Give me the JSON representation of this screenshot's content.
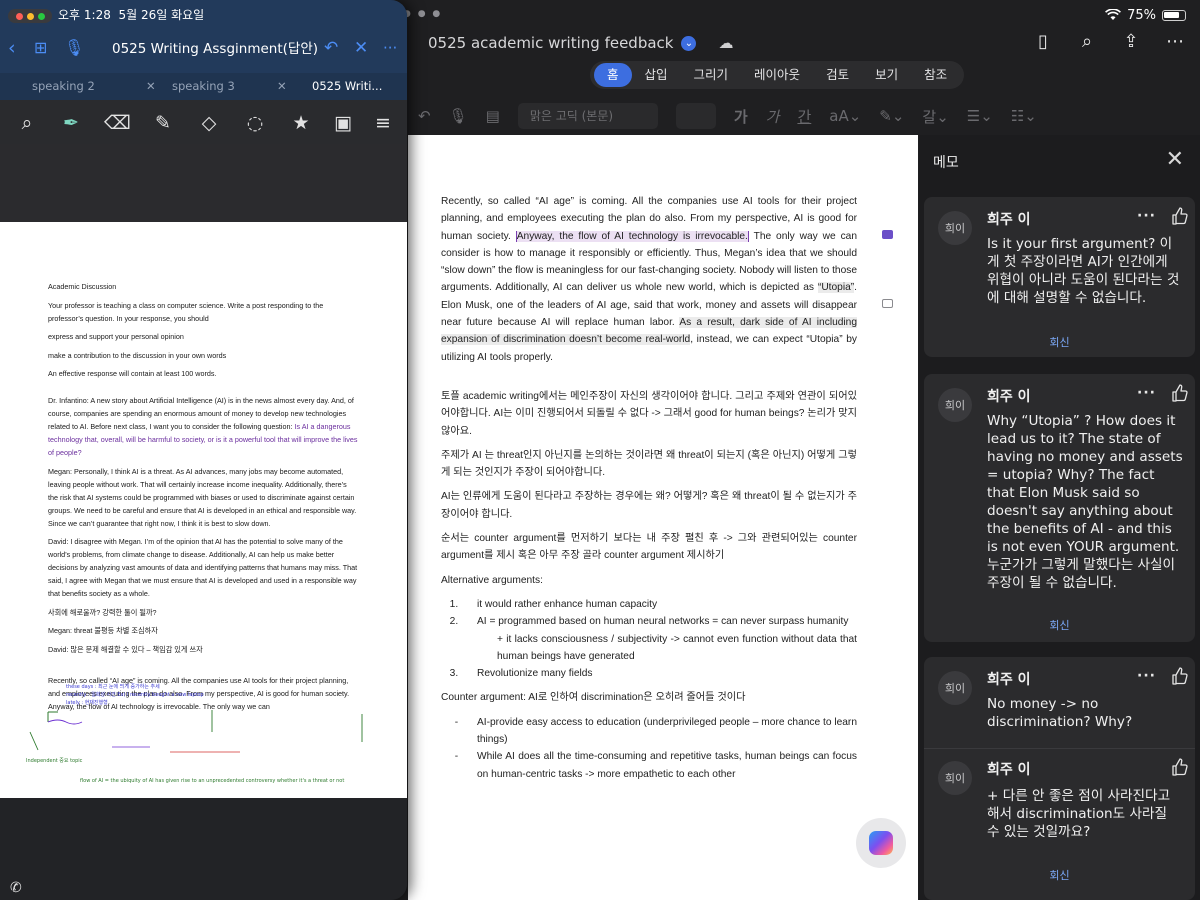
{
  "status": {
    "time": "오후 1:28",
    "date": "5월 26일 화요일",
    "battery": "75%"
  },
  "word": {
    "doc_title": "0525 academic writing feedback",
    "ribbon_tabs": [
      "홈",
      "삽입",
      "그리기",
      "레이아웃",
      "검토",
      "보기",
      "참조"
    ],
    "font_name": "맑은 고딕 (본문)",
    "paragraphs": {
      "p1_a": "Recently, so called “AI age” is coming. All the companies use AI tools for their project planning, and employees executing the plan do also. From my perspective, AI is good for human society. ",
      "p1_hl1": "Anyway, the flow of AI technology is irrevocable.",
      "p1_b": " The only way we can consider is how to manage it responsibly or efficiently. Thus, Megan’s idea that we should “slow down” the flow is meaningless for our fast-changing society. Nobody will listen to those arguments. Additionally, AI can deliver us whole new world, which is depicted as ",
      "p1_hl2": "“Utopia”",
      "p1_c": ". Elon Musk, one of the leaders of AI age, said that work, money and assets will disappear near future because AI will replace human labor. ",
      "p1_hl3": "As a result, dark side of AI including expansion of discrimination doesn’t become real-world",
      "p1_d": ", instead, we can expect “Utopia” by utilizing AI tools properly.",
      "k1": "토플 academic writing에서는 메인주장이 자신의 생각이어야 합니다. 그리고 주제와 연관이 되어있어야합니다. AI는 이미 진행되어서 되돌릴 수 없다 -> 그래서 good for human beings? 논리가 맞지 않아요.",
      "k2": "주제가 AI 는 threat인지 아닌지를 논의하는 것이라면 왜 threat이 되는지 (혹은 아닌지) 어떻게 그렇게 되는 것인지가 주장이 되어야합니다.",
      "k3": "AI는 인류에게 도움이 된다라고 주장하는 경우에는 왜? 어떻게? 혹은 왜 threat이 될 수 없는지가 주장이어야 합니다.",
      "k4": "순서는 counter argument를 먼저하기 보다는 내 주장 펼친 후 -> 그와 관련되어있는 counter argument를 제시 혹은 아무 주장 골라 counter argument 제시하기",
      "alt_heading": "Alternative arguments:",
      "alt_1": "it would rather enhance human capacity",
      "alt_2": "AI = programmed based on human neural networks = can never surpass humanity",
      "alt_2b": "+ it lacks consciousness / subjectivity -> cannot even function without data that human beings have generated",
      "alt_3": "Revolutionize many fields",
      "counter_heading": "Counter argument: AI로 인하여 discrimination은 오히려 줄어들 것이다",
      "counter_1": "AI-provide easy access to education (underprivileged people – more chance to learn things)",
      "counter_2": "While AI does all the time-consuming and repetitive tasks, human beings can focus on human-centric tasks -> more empathetic to each other"
    }
  },
  "memo": {
    "title": "메모",
    "reply_label": "회신",
    "comments": [
      {
        "avatar": "희이",
        "author": "희주 이",
        "text": "Is it your first argument?  이게 첫 주장이라면 AI가 인간에게 위협이 아니라 도움이 된다라는 것에 대해 설명할 수 없습니다."
      },
      {
        "avatar": "희이",
        "author": "희주 이",
        "text": "Why “Utopia” ? How does it lead us to it? The state of having no money and assets = utopia? Why? The fact that Elon Musk said so doesn't say anything about the benefits of AI - and this is not even YOUR argument. 누군가가 그렇게 말했다는 사실이 주장이 될 수 없습니다."
      },
      {
        "avatar": "희이",
        "author": "희주 이",
        "text": "No money -> no discrimination? Why?"
      },
      {
        "avatar": "희이",
        "author": "희주 이",
        "text": "+ 다른 안 좋은 점이 사라진다고 해서 discrimination도 사라질 수 있는 것일까요?"
      }
    ]
  },
  "notes": {
    "title": "0525 Writing Assginment(답안)",
    "tabs": [
      "speaking 2",
      "speaking 3",
      "0525 Writi..."
    ],
    "sheet": {
      "heading": "Academic Discussion",
      "s1": "Your professor is teaching a class on computer science. Write a post responding to the professor’s question.    In your response, you should",
      "s2": "express and support your personal opinion",
      "s3": "make a contribution to the discussion in your own words",
      "s4": "An effective response will contain at least 100 words.",
      "s5": "Dr. Infantino:   A new story about Artificial Intelligence (AI) is in the news almost every day.   And, of course, companies are spending an enormous amount of money to develop new technologies related to AI. Before next class, I want you to consider the following question: ",
      "s5_q": "Is AI a dangerous technology that, overall, will be harmful to society, or is it a powerful tool that will improve the lives of people?",
      "s6": "Megan: Personally, I think AI is a threat. As AI advances, many jobs may become automated, leaving people without work. That will certainly increase income inequality. Additionally, there’s the risk that AI systems could be programmed with biases or used to discriminate against certain groups. We need to be careful and ensure that AI is developed in an ethical and responsible way.   Since we can’t guarantee that right now, I think it is best to slow down.",
      "s7": "David: I disagree with Megan. I’m of the opinion that AI has the potential to solve many of the world’s problems, from climate change to disease. Additionally, AI can help us make better decisions by analyzing vast amounts of data and identifying patterns that humans may miss. That said, I agree with Megan that we must ensure that AI is developed and used in a responsible way that benefits society as a whole.",
      "s8": "사회에 해로울까? 강력한 툴이 될까?",
      "s9": "Megan: threat 불평등 차별 조심하자",
      "s10": "David: 많은 문제 해결할 수 있다 – 책임감 있게 쓰자",
      "s11": "Recently, so called “AI age” is coming. All the companies use AI tools for their project planning, and employees executing the plan do also. From my perspective, AI is good for human society. Anyway, the flow of AI technology is irrevocable. The only way we can",
      "h1": "these days : 최근 눈에 띄게 증가하는 추세",
      "h2": "recently : 일회성 사건 Ex) I recently bought a new laptop",
      "h3": "lately : 현재진행형",
      "h4": "flow of AI  =  the ubiquity of AI has given rise to an unprecedented controversy whether it's a threat or not",
      "h5": "Independent 중요 topic"
    }
  },
  "colors": {
    "accent": "#3d6ee0",
    "notes_header": "#223a5b",
    "memo_link": "#7aa7f5"
  }
}
